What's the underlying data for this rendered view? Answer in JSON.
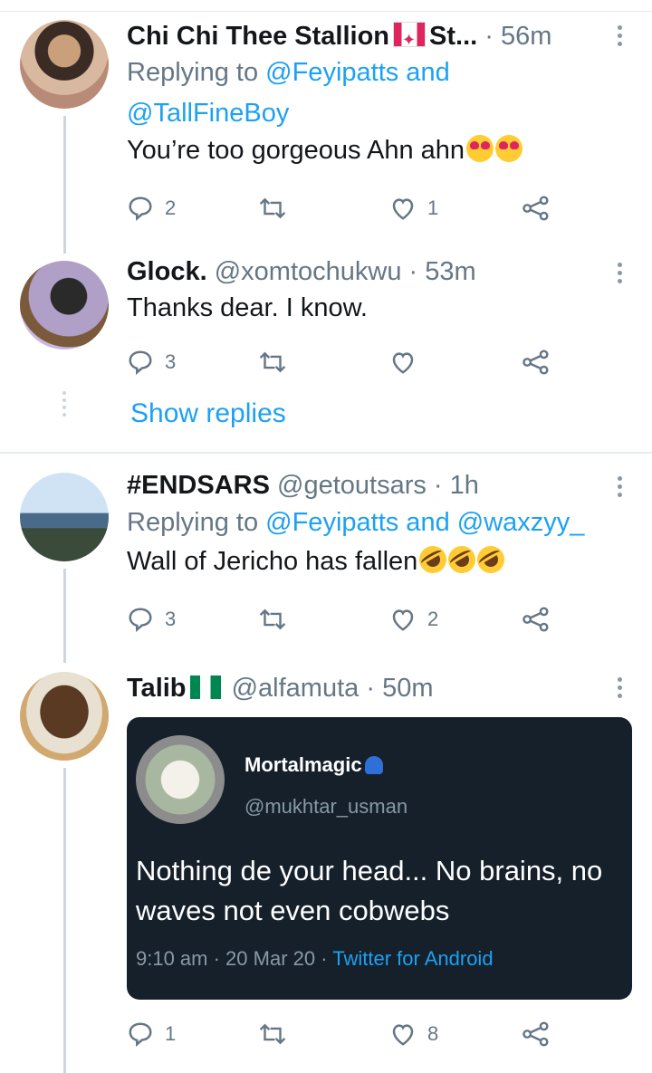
{
  "tweets": [
    {
      "name": "Chi Chi Thee Stallion",
      "name_suffix": "St...",
      "time": "56m",
      "reply_prefix": "Replying to",
      "reply_handles": "@Feyipatts and",
      "reply_handles2": "@TallFineBoy",
      "text": "You’re too gorgeous Ahn ahn",
      "replies": "2",
      "retweets": "",
      "likes": "1"
    },
    {
      "name": "Glock.",
      "handle": "@xomtochukwu",
      "time": "53m",
      "text": "Thanks dear. I know.",
      "replies": "3",
      "retweets": "",
      "likes": ""
    },
    {
      "name": "#ENDSARS",
      "handle": "@getoutsars",
      "time": "1h",
      "reply_prefix": "Replying to",
      "reply_handles": "@Feyipatts and @waxzyy_",
      "text": "Wall of Jericho has fallen",
      "replies": "3",
      "retweets": "",
      "likes": "2"
    },
    {
      "name": "Talib",
      "handle": "@alfamuta",
      "time": "50m",
      "replies": "1",
      "retweets": "",
      "likes": "8"
    }
  ],
  "show_replies": "Show replies",
  "separator": "·",
  "quote": {
    "name": "Mortalmagic",
    "handle": "@mukhtar_usman",
    "text": "Nothing de your head... No brains, no waves not even cobwebs",
    "time": "9:10 am · 20 Mar 20 · ",
    "source": "Twitter for Android"
  },
  "colors": {
    "accent": "#1da1f2",
    "secondary_text": "#657786",
    "thread_line": "#ccd6dd",
    "quote_bg": "#15202b"
  },
  "icons": [
    "reply-icon",
    "retweet-icon",
    "like-icon",
    "share-icon",
    "more-icon"
  ]
}
